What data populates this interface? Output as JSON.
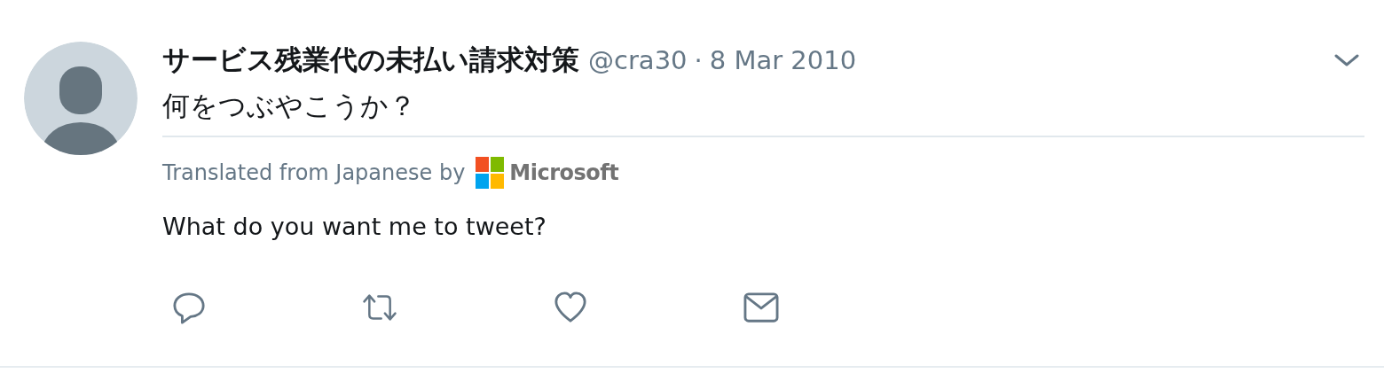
{
  "tweet": {
    "display_name": "サービス残業代の未払い請求対策",
    "handle": "@cra30",
    "separator": "·",
    "date": "8 Mar 2010",
    "text": "何をつぶやこうか？",
    "translation": {
      "label": "Translated from Japanese by",
      "provider": "Microsoft",
      "text": "What do you want me to tweet?"
    }
  }
}
